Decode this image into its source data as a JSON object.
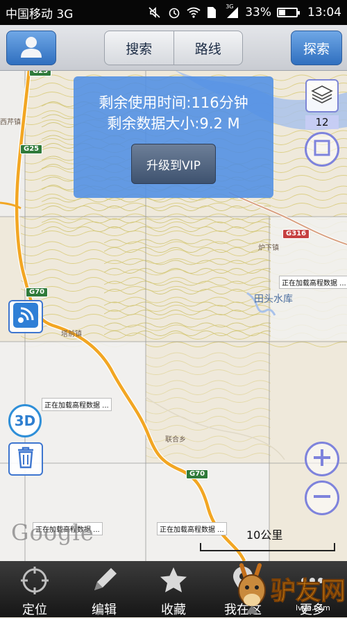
{
  "status_bar": {
    "carrier": "中国移动 3G",
    "network": "3G",
    "battery": "33%",
    "battery_level": 0.33,
    "time": "13:04",
    "icons": [
      "mute-icon",
      "alarm-icon",
      "wifi-icon",
      "sim-icon",
      "signal-icon",
      "battery-icon"
    ]
  },
  "toolbar": {
    "avatar_icon": "user-avatar-icon",
    "search_label": "搜索",
    "route_label": "路线",
    "explore_label": "探索"
  },
  "quota": {
    "time_remaining": "剩余使用时间:116分钟",
    "data_remaining": "剩余数据大小:9.2 M",
    "upgrade_label": "升级到VIP"
  },
  "map": {
    "zoom_level": "12",
    "scale_label": "10公里",
    "attribution": "Google",
    "loading_text": "正在加载高程数据 ...",
    "places": [
      "西芹镇",
      "炉下镇",
      "塔前镇",
      "联合乡"
    ],
    "lake": "田头水库",
    "road_shields": [
      {
        "label": "G25",
        "color": "#2f7a3a"
      },
      {
        "label": "G25",
        "color": "#2f7a3a"
      },
      {
        "label": "G70",
        "color": "#2f7a3a"
      },
      {
        "label": "G70",
        "color": "#2f7a3a"
      },
      {
        "label": "G316",
        "color": "#c64040"
      }
    ],
    "colors": {
      "highway": "#f2a623",
      "contour": "#d9cf86",
      "water": "#a9c2ea",
      "background": "#efe9db",
      "accent": "#508ee4"
    }
  },
  "controls": {
    "layers_icon": "layers-icon",
    "frame_icon": "square-frame-icon",
    "locate_signal_icon": "satellite-signal-icon",
    "label_3d": "3D",
    "trash_icon": "trash-icon",
    "zoom_in_icon": "plus-icon",
    "zoom_out_icon": "minus-icon"
  },
  "tabs": [
    {
      "label": "定位",
      "icon": "crosshair-icon"
    },
    {
      "label": "编辑",
      "icon": "pencil-icon"
    },
    {
      "label": "收藏",
      "icon": "star-icon"
    },
    {
      "label": "我在这",
      "icon": "location-pin-icon"
    },
    {
      "label": "更多",
      "icon": "more-icon"
    }
  ],
  "watermark": {
    "text": "驴友网",
    "sub": "lvye.com"
  }
}
